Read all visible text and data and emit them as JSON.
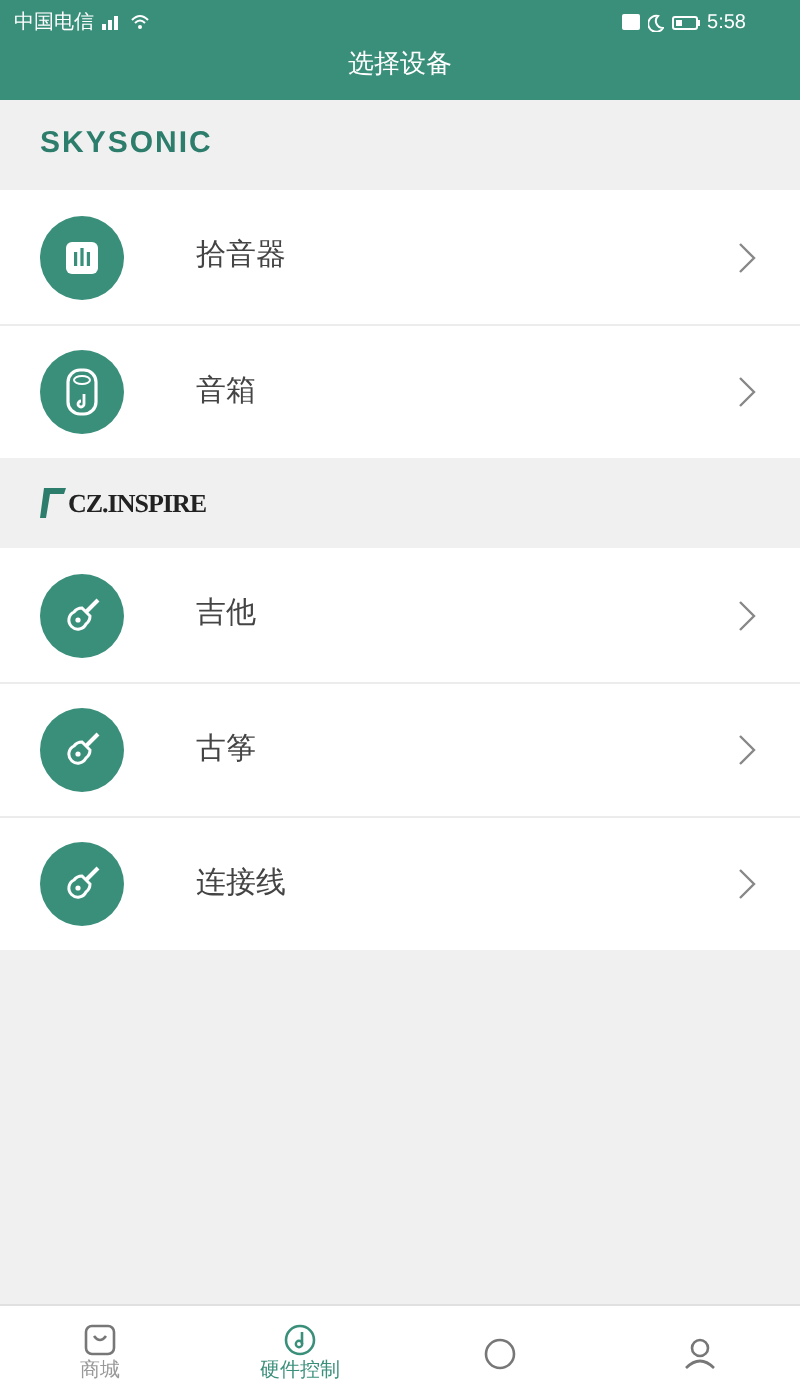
{
  "status_bar": {
    "carrier": "中国电信",
    "time": "5:58"
  },
  "title": "选择设备",
  "sections": [
    {
      "brand": "SKYSONIC",
      "kind": "skysonic",
      "devices": [
        {
          "label": "拾音器",
          "kind": "pickup"
        },
        {
          "label": "音箱",
          "kind": "speaker"
        }
      ]
    },
    {
      "brand": "CZ.INSPIRE",
      "kind": "czinspire",
      "devices": [
        {
          "label": "吉他",
          "kind": "guitar"
        },
        {
          "label": "古筝",
          "kind": "guitar"
        },
        {
          "label": "连接线",
          "kind": "guitar"
        }
      ]
    }
  ],
  "tab_bar": [
    {
      "label": "商城",
      "kind": "shop",
      "selected": false
    },
    {
      "label": "硬件控制",
      "kind": "music",
      "selected": true
    },
    {
      "kind": "circle",
      "selected": false
    },
    {
      "kind": "person",
      "selected": false
    }
  ]
}
